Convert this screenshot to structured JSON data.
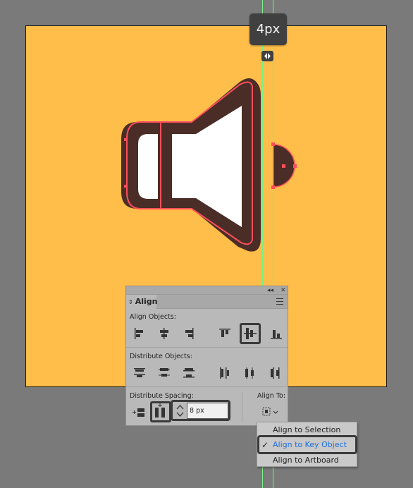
{
  "tooltip": {
    "text": "4px"
  },
  "colors": {
    "canvas": "#7a7a7a",
    "artboard": "#ffbd4a",
    "outline": "#4a2d27",
    "selection": "#ff4e5a",
    "guide": "#7cf08a",
    "speaker_fill": "#ffffff"
  },
  "panel": {
    "title": "Align",
    "collapse_icon": "double-chevron-left-icon",
    "close_icon": "close-icon",
    "menu_icon": "panel-menu-icon",
    "align_objects_label": "Align Objects:",
    "distribute_objects_label": "Distribute Objects:",
    "distribute_spacing_label": "Distribute Spacing:",
    "align_to_label": "Align To:",
    "spacing_value": "8 px",
    "align_objects_buttons": [
      "horizontal-align-left",
      "horizontal-align-center",
      "horizontal-align-right",
      "vertical-align-top",
      "vertical-align-center",
      "vertical-align-bottom"
    ],
    "distribute_objects_buttons": [
      "vertical-distribute-top",
      "vertical-distribute-center",
      "vertical-distribute-bottom",
      "horizontal-distribute-left",
      "horizontal-distribute-center",
      "horizontal-distribute-right"
    ],
    "distribute_spacing_buttons": [
      "vertical-distribute-space",
      "horizontal-distribute-space"
    ],
    "active_align_button": "vertical-align-center",
    "active_spacing_button": "horizontal-distribute-space"
  },
  "align_to_menu": {
    "items": [
      {
        "label": "Align to Selection",
        "checked": false
      },
      {
        "label": "Align to Key Object",
        "checked": true
      },
      {
        "label": "Align to Artboard",
        "checked": false
      }
    ],
    "check_glyph": "✓"
  }
}
